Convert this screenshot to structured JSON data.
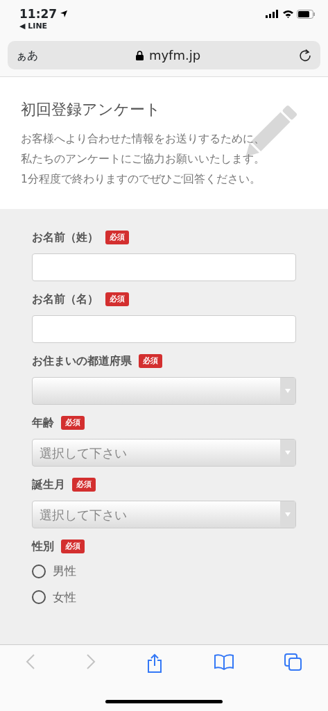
{
  "status_bar": {
    "time": "11:27",
    "back_app": "◀ LINE"
  },
  "address_bar": {
    "text_size": "ぁあ",
    "domain": "myfm.jp"
  },
  "header": {
    "title": "初回登録アンケート",
    "description": [
      "お客様へより合わせた情報をお送りするために、",
      "私たちのアンケートにご協力お願いいたします。",
      "1分程度で終わりますのでぜひご回答ください。"
    ]
  },
  "fields": [
    {
      "kind": "text",
      "label": "お名前（姓）",
      "badge": "必須"
    },
    {
      "kind": "text",
      "label": "お名前（名）",
      "badge": "必須"
    },
    {
      "kind": "select",
      "label": "お住まいの都道府県",
      "badge": "必須"
    },
    {
      "kind": "select",
      "label": "年齢",
      "badge": "必須",
      "placeholder": "選択して下さい"
    },
    {
      "kind": "select",
      "label": "誕生月",
      "badge": "必須",
      "placeholder": "選択して下さい"
    },
    {
      "kind": "radio",
      "label": "性別",
      "badge": "必須",
      "options": [
        {
          "label": "男性",
          "selected": false
        },
        {
          "label": "女性",
          "selected": false
        }
      ]
    }
  ],
  "toolbar": {
    "back_disabled": true,
    "forward_disabled": true
  }
}
